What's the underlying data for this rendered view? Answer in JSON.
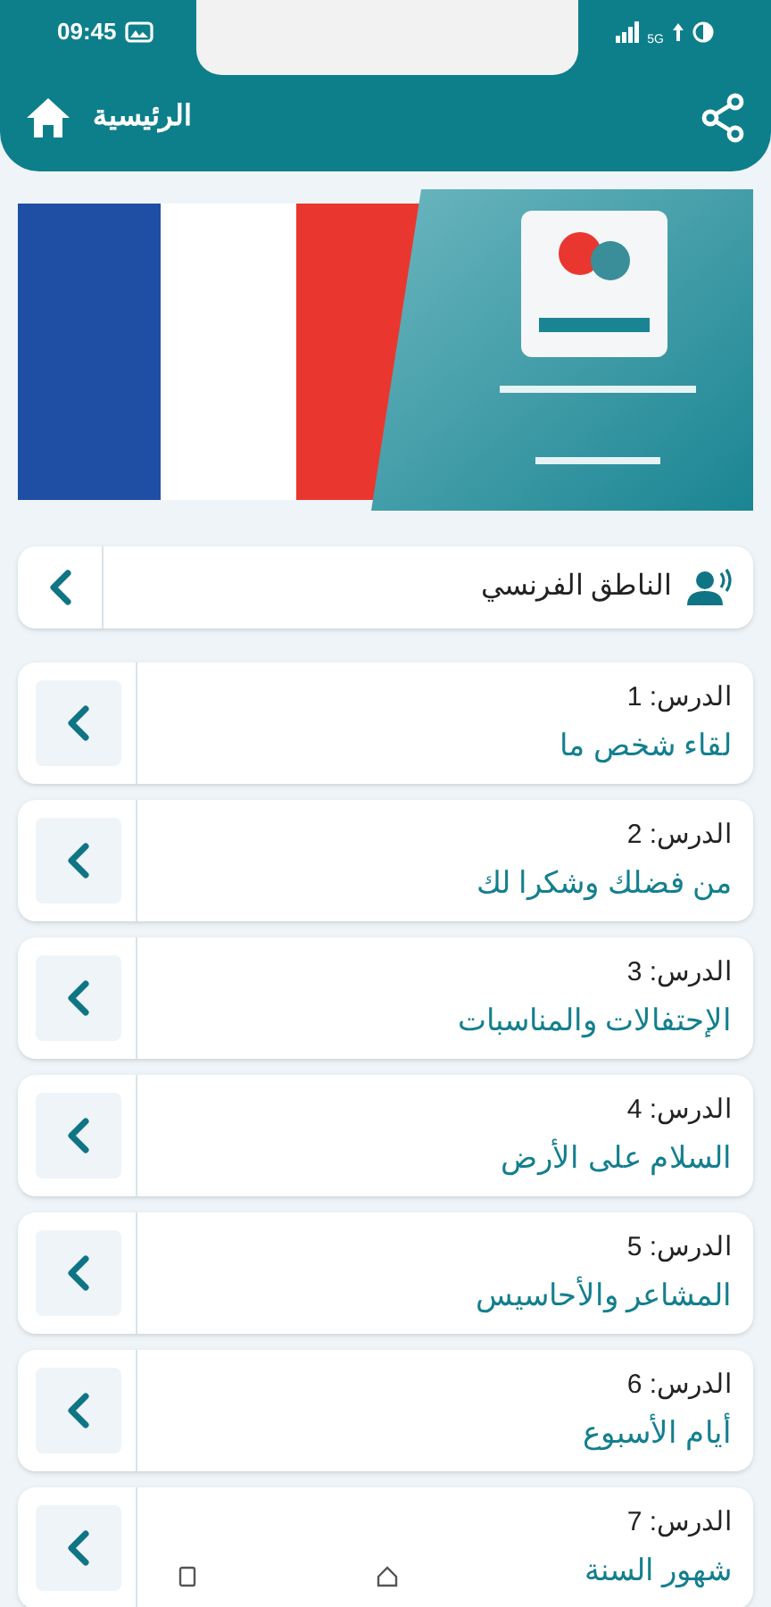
{
  "status_bar": {
    "time": "09:45",
    "network": "5G"
  },
  "header": {
    "title": "الرئيسية"
  },
  "speaker": {
    "label": "الناطق الفرنسي"
  },
  "lessons": [
    {
      "label": "الدرس: 1",
      "title": "لقاء شخص ما"
    },
    {
      "label": "الدرس: 2",
      "title": "من فضلك وشكرا لك"
    },
    {
      "label": "الدرس: 3",
      "title": "الإحتفالات والمناسبات"
    },
    {
      "label": "الدرس: 4",
      "title": "السلام على الأرض"
    },
    {
      "label": "الدرس: 5",
      "title": "المشاعر والأحاسيس"
    },
    {
      "label": "الدرس: 6",
      "title": "أيام الأسبوع"
    },
    {
      "label": "الدرس: 7",
      "title": "شهور السنة"
    }
  ]
}
